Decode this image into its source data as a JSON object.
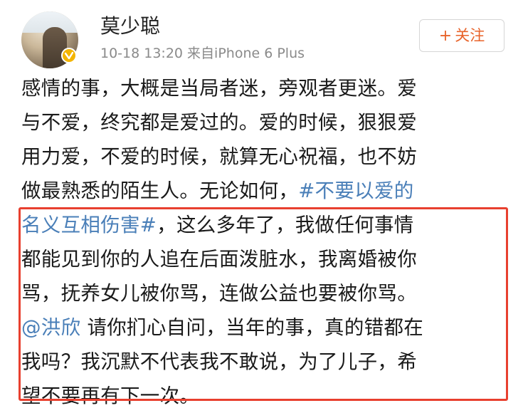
{
  "user": {
    "name": "莫少聪",
    "meta": "10-18 13:20 来自iPhone 6 Plus"
  },
  "follow_button": {
    "plus": "+",
    "label": "关注"
  },
  "post": {
    "line1": "感情的事，大概是当局者迷，旁观者更迷。爱",
    "line2": "与不爱，终究都是爱过的。爱的时候，狠狠爱",
    "line3": "用力爱，不爱的时候，就算无心祝福，也不妨",
    "line4_text": "做最熟悉的陌生人。无论如何，",
    "line4_link": "#不要以爱的",
    "line5_link": "名义互相伤害#",
    "line5_text": "，这么多年了，我做任何事情",
    "line6": "都能见到你的人追在后面泼脏水，我离婚被你",
    "line7": "骂，抚养女儿被你骂，连做公益也要被你骂。",
    "line8_mention": "@洪欣",
    "line8_text": " 请你扪心自问，当年的事，真的错都在",
    "line9": "我吗？我沉默不代表我不敢说，为了儿子，希",
    "line10": "望不要再有下一次。"
  },
  "colors": {
    "link": "#4a7fb8",
    "follow": "#e8632a",
    "highlight": "#e8402f",
    "verified": "#f3b400"
  }
}
